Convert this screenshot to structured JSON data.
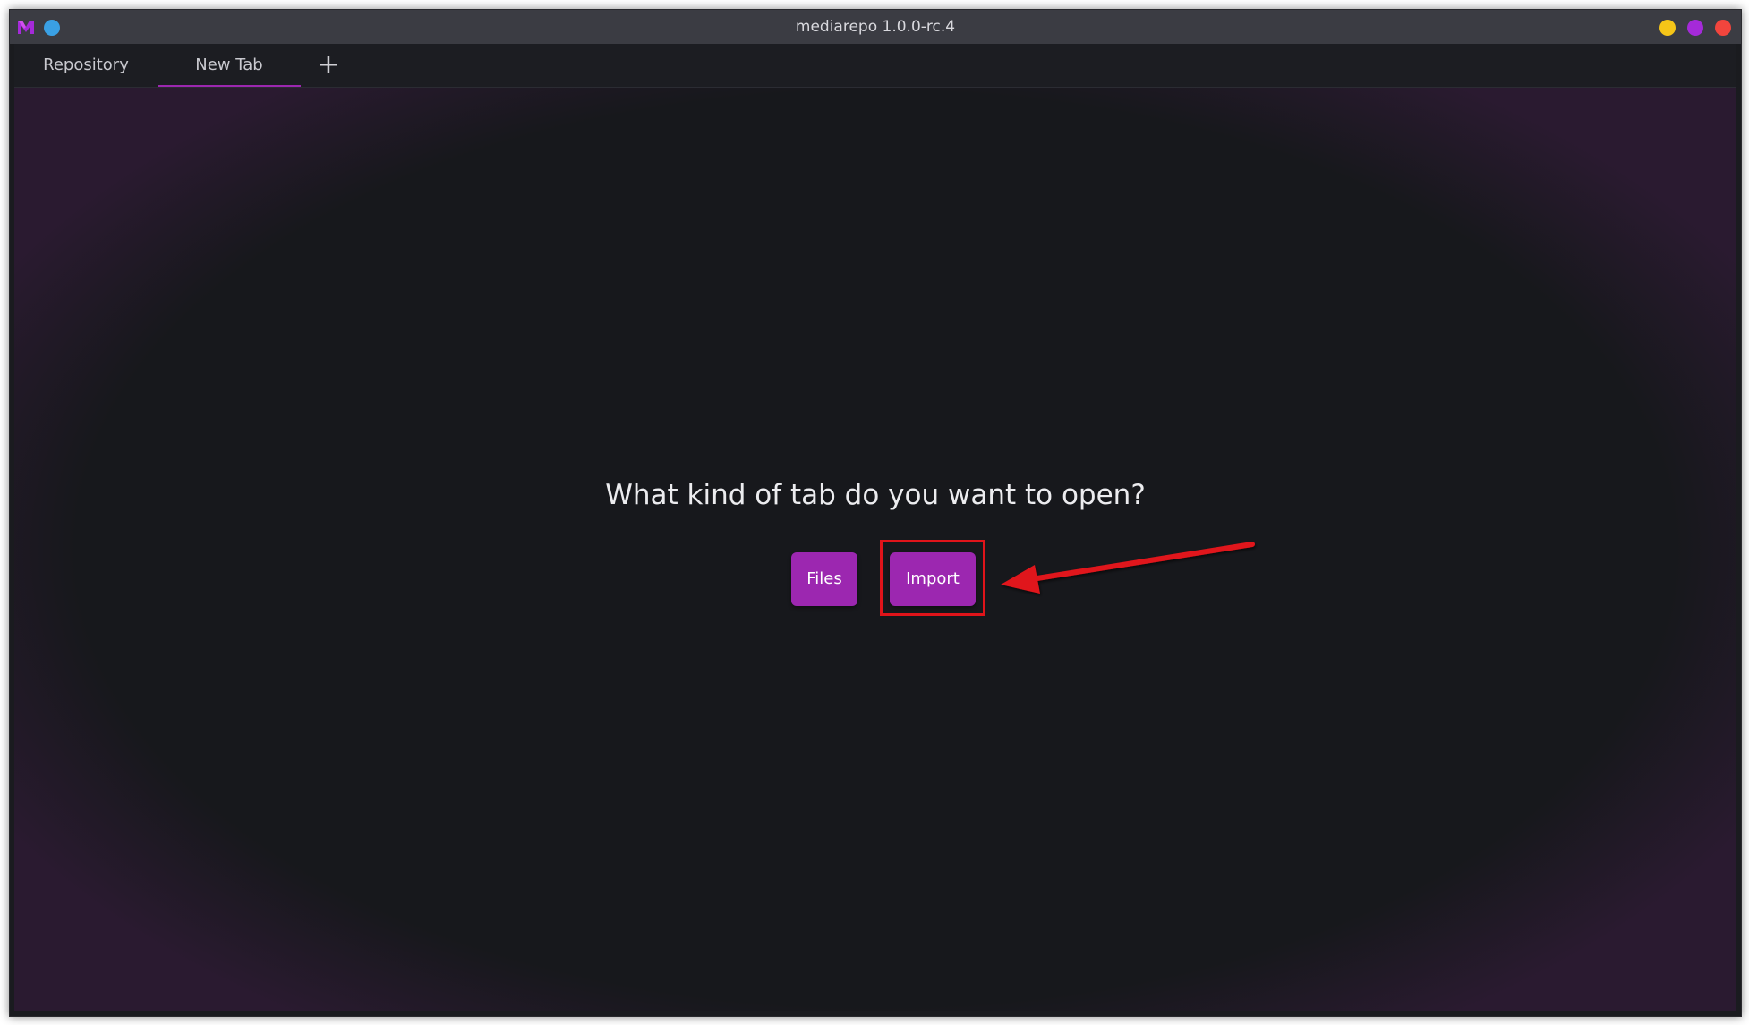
{
  "window": {
    "title": "mediarepo 1.0.0-rc.4"
  },
  "titlebar_icons": {
    "app_logo": "mediarepo-logo-icon",
    "pin": "pin-icon",
    "minimize": "minimize-icon",
    "maximize": "maximize-icon",
    "close": "close-icon"
  },
  "tabs": [
    {
      "label": "Repository",
      "active": false
    },
    {
      "label": "New Tab",
      "active": true
    }
  ],
  "add_tab_label": "+",
  "main": {
    "prompt": "What kind of tab do you want to open?",
    "buttons": {
      "files": "Files",
      "import": "Import"
    }
  },
  "colors": {
    "accent": "#9c27b0",
    "annotation": "#e0141a",
    "background": "#17181c",
    "titlebar": "#3b3c43"
  }
}
